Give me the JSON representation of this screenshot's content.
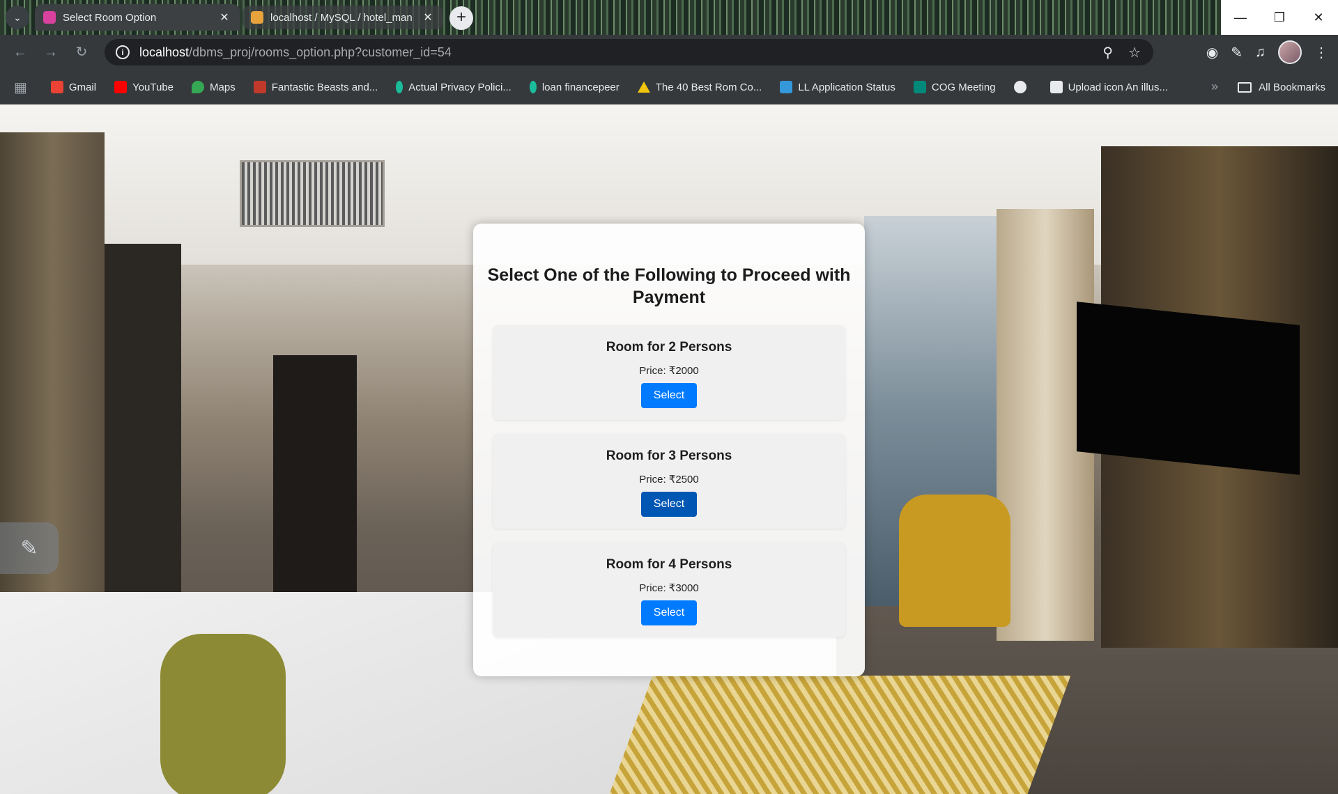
{
  "browser": {
    "tabs": [
      {
        "title": "Select Room Option",
        "active": true
      },
      {
        "title": "localhost / MySQL / hotel_man",
        "active": false
      }
    ],
    "url_host": "localhost",
    "url_path": "/dbms_proj/rooms_option.php?customer_id=54",
    "bookmarks": [
      {
        "label": "Gmail",
        "icon": "gmail-icon",
        "color": "#ea4335"
      },
      {
        "label": "YouTube",
        "icon": "youtube-icon",
        "color": "#ff0000"
      },
      {
        "label": "Maps",
        "icon": "maps-icon",
        "color": "#34a853"
      },
      {
        "label": "Fantastic Beasts and...",
        "icon": "page-icon",
        "color": "#c0392b"
      },
      {
        "label": "Actual Privacy Polici...",
        "icon": "drop-icon",
        "color": "#1abc9c"
      },
      {
        "label": "loan financepeer",
        "icon": "drop-icon",
        "color": "#1abc9c"
      },
      {
        "label": "The 40 Best Rom Co...",
        "icon": "triangle-icon",
        "color": "#f1c40f"
      },
      {
        "label": "LL Application Status",
        "icon": "building-icon",
        "color": "#3498db"
      },
      {
        "label": "COG Meeting",
        "icon": "meet-icon",
        "color": "#00897b"
      },
      {
        "label": "",
        "icon": "globe-icon",
        "color": "#e8eaed"
      },
      {
        "label": "Upload icon An illus...",
        "icon": "building-icon",
        "color": "#e8eaed"
      }
    ],
    "all_bookmarks": "All Bookmarks"
  },
  "page": {
    "heading": "Select One of the Following to Proceed with Payment",
    "options": [
      {
        "title": "Room for 2 Persons",
        "price": "Price: ₹2000",
        "button": "Select"
      },
      {
        "title": "Room for 3 Persons",
        "price": "Price: ₹2500",
        "button": "Select"
      },
      {
        "title": "Room for 4 Persons",
        "price": "Price: ₹3000",
        "button": "Select"
      }
    ]
  },
  "colors": {
    "button": "#007bff",
    "button_hover": "#0056b3"
  }
}
